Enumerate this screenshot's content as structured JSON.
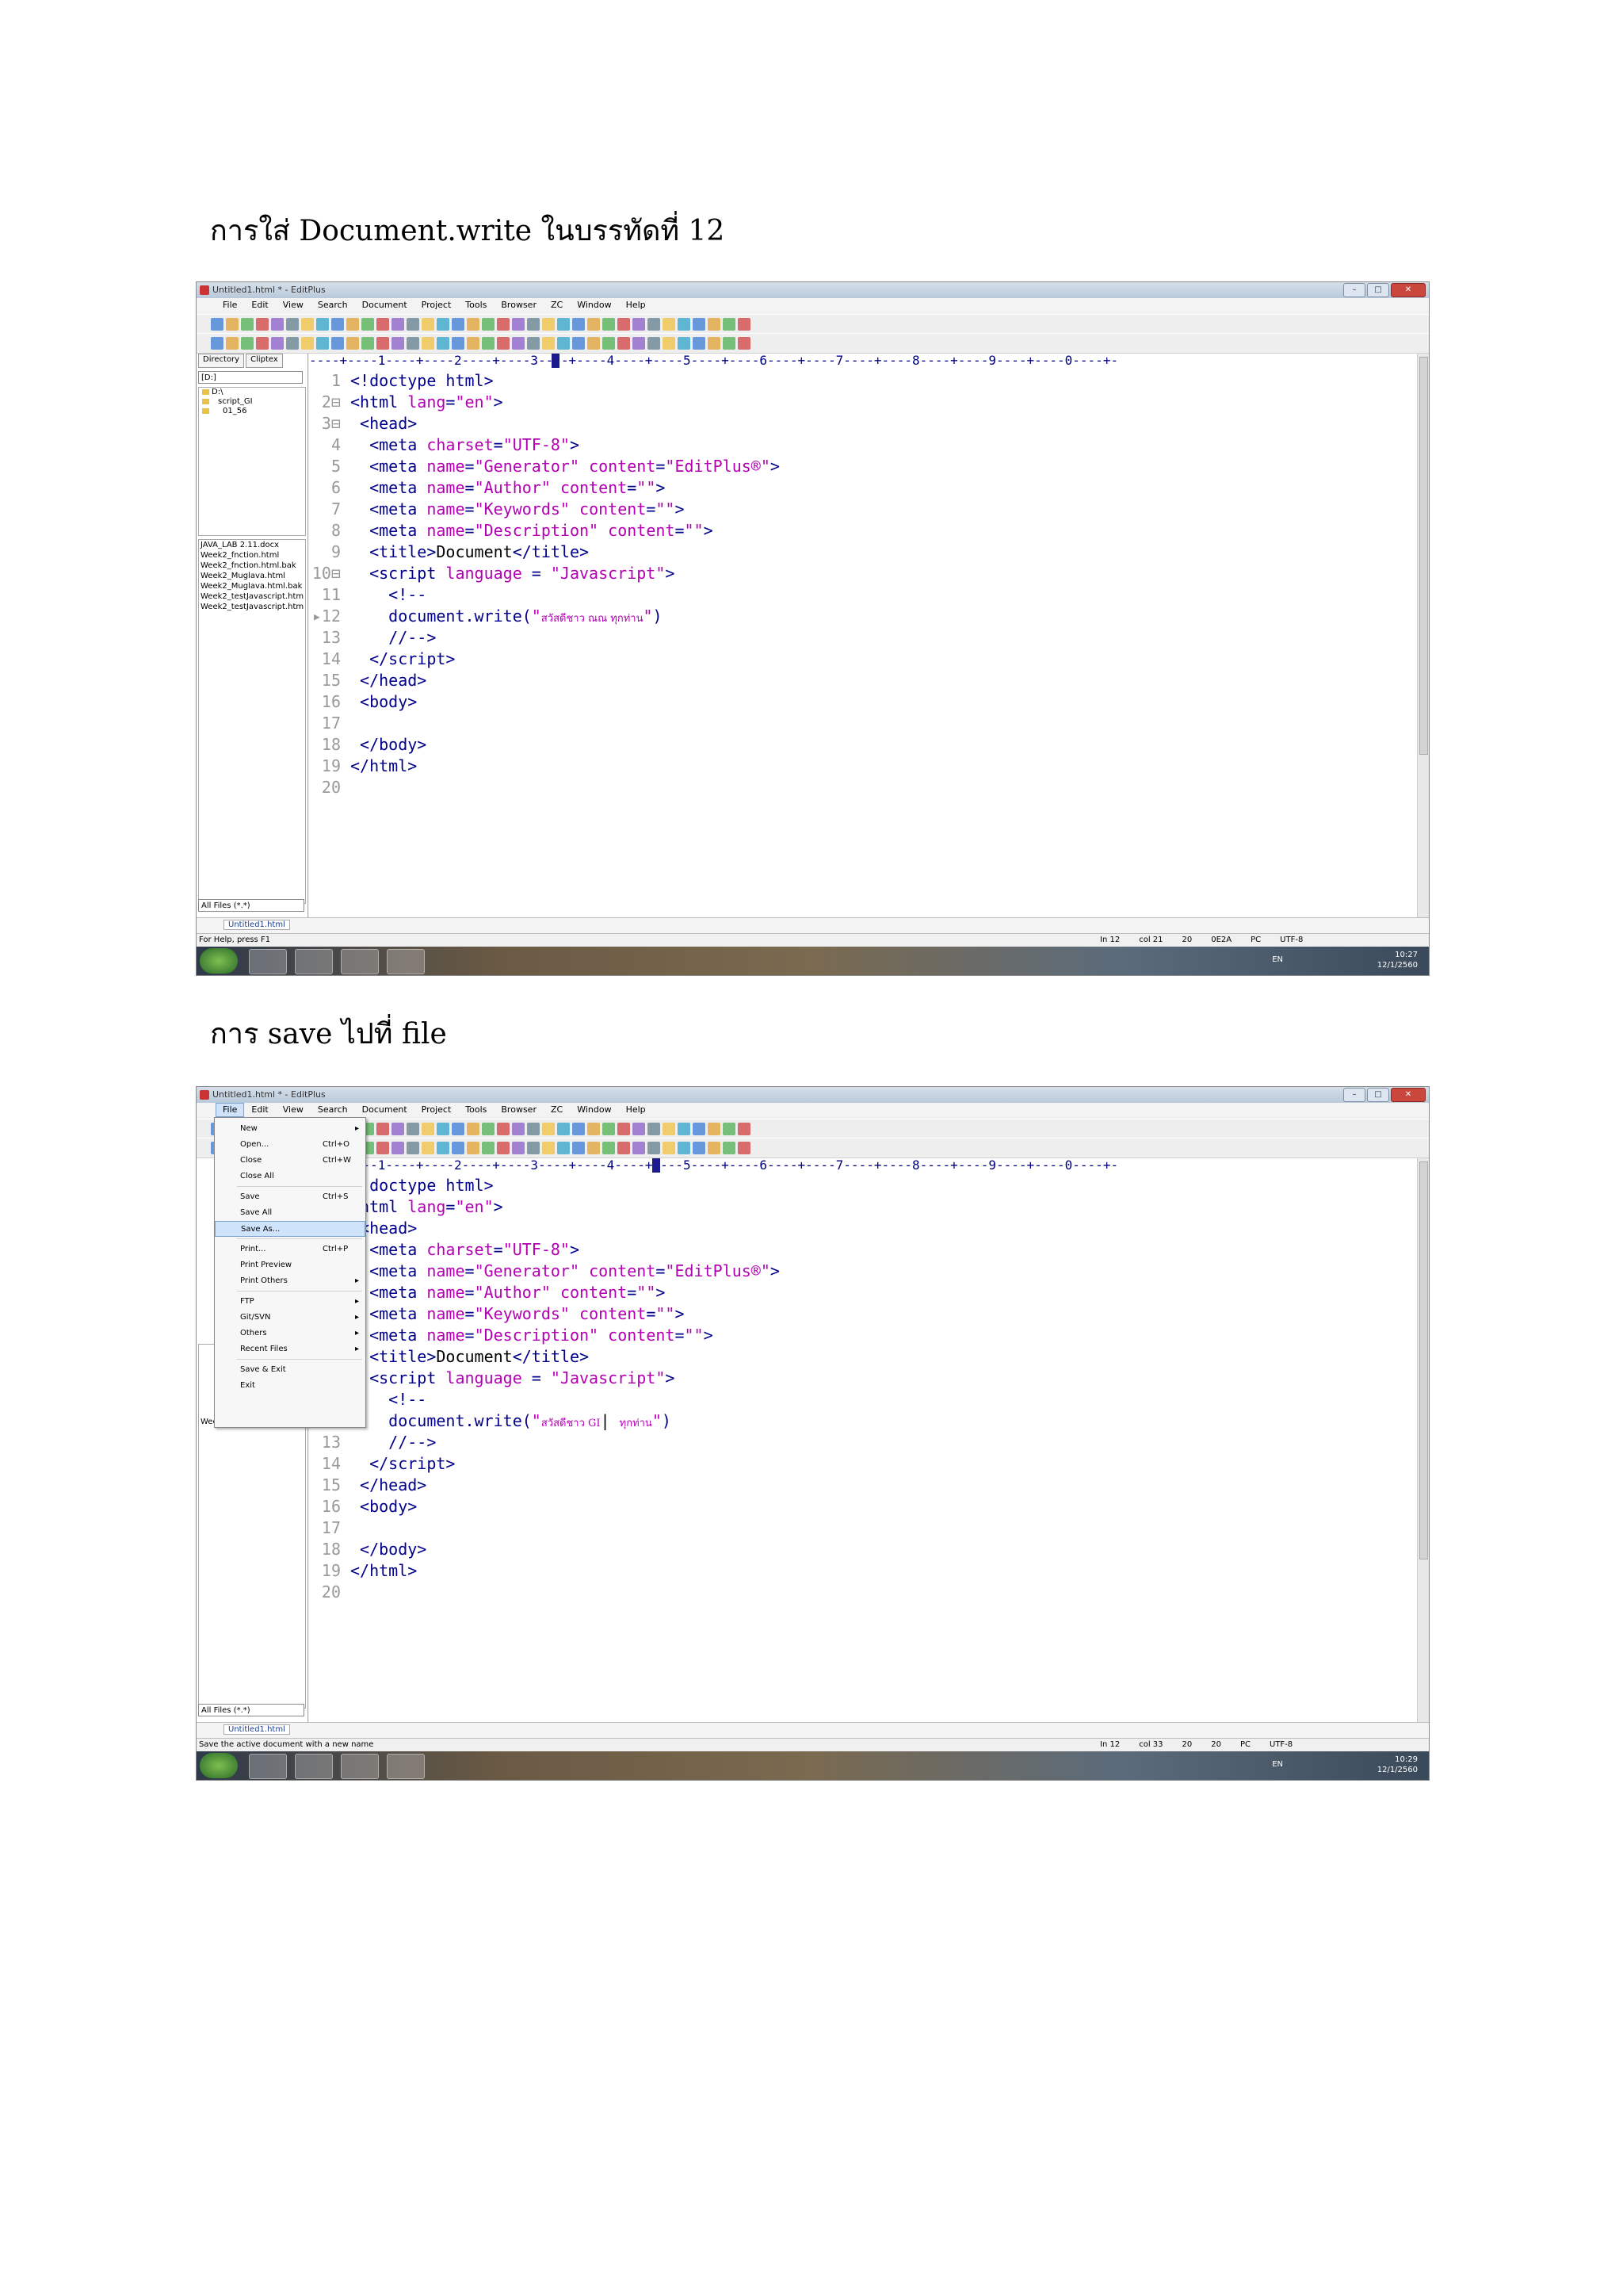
{
  "captions": {
    "first": "การใส่ Document.write ในบรรทัดที่ 12",
    "second": "การ save ไปที่ file"
  },
  "app": {
    "title": "Untitled1.html * - EditPlus",
    "menu": [
      "File",
      "Edit",
      "View",
      "Search",
      "Document",
      "Project",
      "Tools",
      "Browser",
      "ZC",
      "Window",
      "Help"
    ]
  },
  "sidebar": {
    "tabs": [
      "Directory",
      "Cliptex"
    ],
    "drive": "[D:]",
    "folders": [
      "D:\\",
      "script_GI",
      "01_56"
    ],
    "files": [
      "JAVA_LAB 2.11.docx",
      "Week2_fnction.html",
      "Week2_fnction.html.bak",
      "Week2_Muglava.html",
      "Week2_Muglava.html.bak",
      "Week2_testJavascript.htm",
      "Week2_testJavascript.htm"
    ],
    "filter": "All Files (*.*)"
  },
  "ruler": "----+----1----+----2----+----3----+----4----+----5----+----6----+----7----+----8----+----9----+----0----+-",
  "document_tab": "Untitled1.html",
  "code_shot1": {
    "line12_thai": "สวัสดีชาว ณณ ทุกท่าน"
  },
  "code_shot2": {
    "line12_thai": "สวัสดีชาว GI",
    "line12_thai_end": "ทุกท่าน"
  },
  "status1": {
    "help": "For Help, press F1",
    "ln": "In 12",
    "col": "col 21",
    "n1": "20",
    "n2": "0E2A",
    "mode": "PC",
    "enc": "UTF-8"
  },
  "status2": {
    "help": "Save the active document with a new name",
    "ln": "In 12",
    "col": "col 33",
    "n1": "20",
    "n2": "20",
    "mode": "PC",
    "enc": "UTF-8"
  },
  "taskbar1": {
    "lang": "EN",
    "time": "10:27",
    "date": "12/1/2560"
  },
  "taskbar2": {
    "lang": "EN",
    "time": "10:29",
    "date": "12/1/2560"
  },
  "file_menu": [
    {
      "label": "New",
      "shortcut": "",
      "arrow": "▸"
    },
    {
      "label": "Open...",
      "shortcut": "Ctrl+O",
      "arrow": ""
    },
    {
      "label": "Close",
      "shortcut": "Ctrl+W",
      "arrow": ""
    },
    {
      "label": "Close All",
      "shortcut": "",
      "arrow": ""
    },
    {
      "label": "Save",
      "shortcut": "Ctrl+S",
      "arrow": ""
    },
    {
      "label": "Save All",
      "shortcut": "",
      "arrow": ""
    },
    {
      "label": "Save As...",
      "shortcut": "",
      "arrow": ""
    },
    {
      "label": "Print...",
      "shortcut": "Ctrl+P",
      "arrow": ""
    },
    {
      "label": "Print Preview",
      "shortcut": "",
      "arrow": ""
    },
    {
      "label": "Print Others",
      "shortcut": "",
      "arrow": "▸"
    },
    {
      "label": "FTP",
      "shortcut": "",
      "arrow": "▸"
    },
    {
      "label": "Git/SVN",
      "shortcut": "",
      "arrow": "▸"
    },
    {
      "label": "Others",
      "shortcut": "",
      "arrow": "▸"
    },
    {
      "label": "Recent Files",
      "shortcut": "",
      "arrow": "▸"
    },
    {
      "label": "Save & Exit",
      "shortcut": "",
      "arrow": ""
    },
    {
      "label": "Exit",
      "shortcut": "",
      "arrow": ""
    }
  ]
}
